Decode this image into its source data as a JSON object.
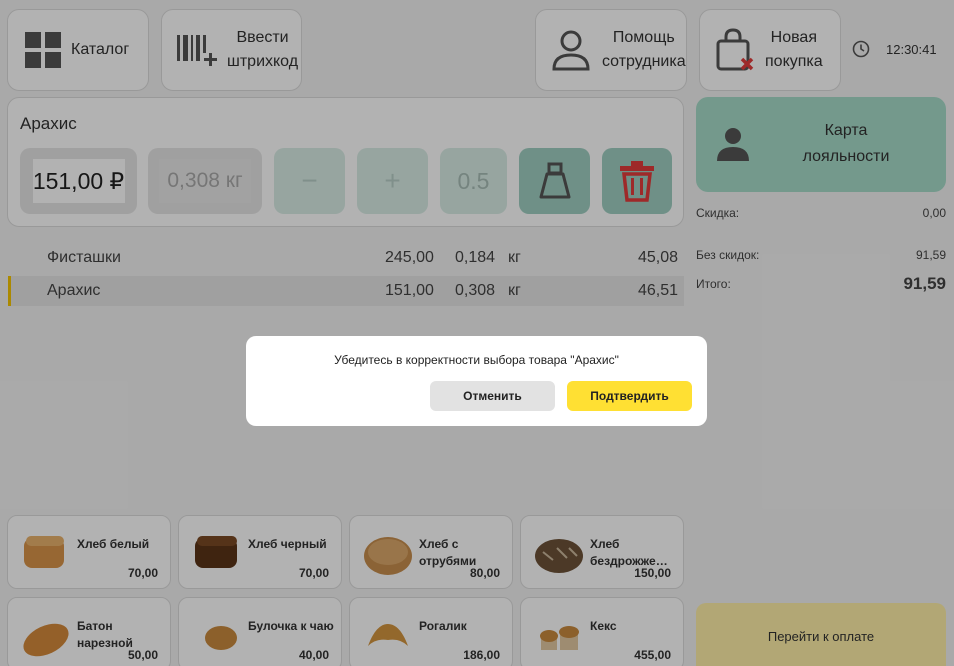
{
  "toolbar": {
    "catalog_label": "Каталог",
    "barcode_label_1": "Ввести",
    "barcode_label_2": "штрихкод",
    "help_label_1": "Помощь",
    "help_label_2": "сотрудника",
    "new_purchase_label_1": "Новая",
    "new_purchase_label_2": "покупка",
    "time": "12:30:41"
  },
  "editor": {
    "product_name": "Арахис",
    "price": "151,00 ₽",
    "weight": "0,308 кг",
    "minus": "−",
    "plus": "+",
    "step": "0.5"
  },
  "cart": {
    "rows": [
      {
        "name": "Фисташки",
        "price": "245,00",
        "qty": "0,184",
        "unit": "кг",
        "sum": "45,08"
      },
      {
        "name": "Арахис",
        "price": "151,00",
        "qty": "0,308",
        "unit": "кг",
        "sum": "46,51"
      }
    ]
  },
  "loyalty": {
    "label_1": "Карта",
    "label_2": "лояльности"
  },
  "totals": {
    "discount_label": "Скидка:",
    "discount_value": "0,00",
    "no_discount_label": "Без скидок:",
    "no_discount_value": "91,59",
    "total_label": "Итого:",
    "total_value": "91,59"
  },
  "products": [
    {
      "name": "Хлеб белый",
      "price": "70,00"
    },
    {
      "name": "Хлеб черный",
      "price": "70,00"
    },
    {
      "name": "Хлеб с отрубями",
      "price": "80,00"
    },
    {
      "name": "Хлеб бездрожже…",
      "price": "150,00"
    },
    {
      "name": "Батон нарезной",
      "price": "50,00"
    },
    {
      "name": "Булочка к чаю",
      "price": "40,00"
    },
    {
      "name": "Рогалик",
      "price": "186,00"
    },
    {
      "name": "Кекс",
      "price": "455,00"
    }
  ],
  "pay_label": "Перейти к оплате",
  "dialog": {
    "message": "Убедитесь в корректности выбора товара \"Арахис\"",
    "cancel_label": "Отменить",
    "confirm_label": "Подтвердить"
  },
  "colors": {
    "accent_yellow": "#ffe033",
    "accent_green": "#a6dcc9",
    "danger_red": "#e23b3b"
  }
}
